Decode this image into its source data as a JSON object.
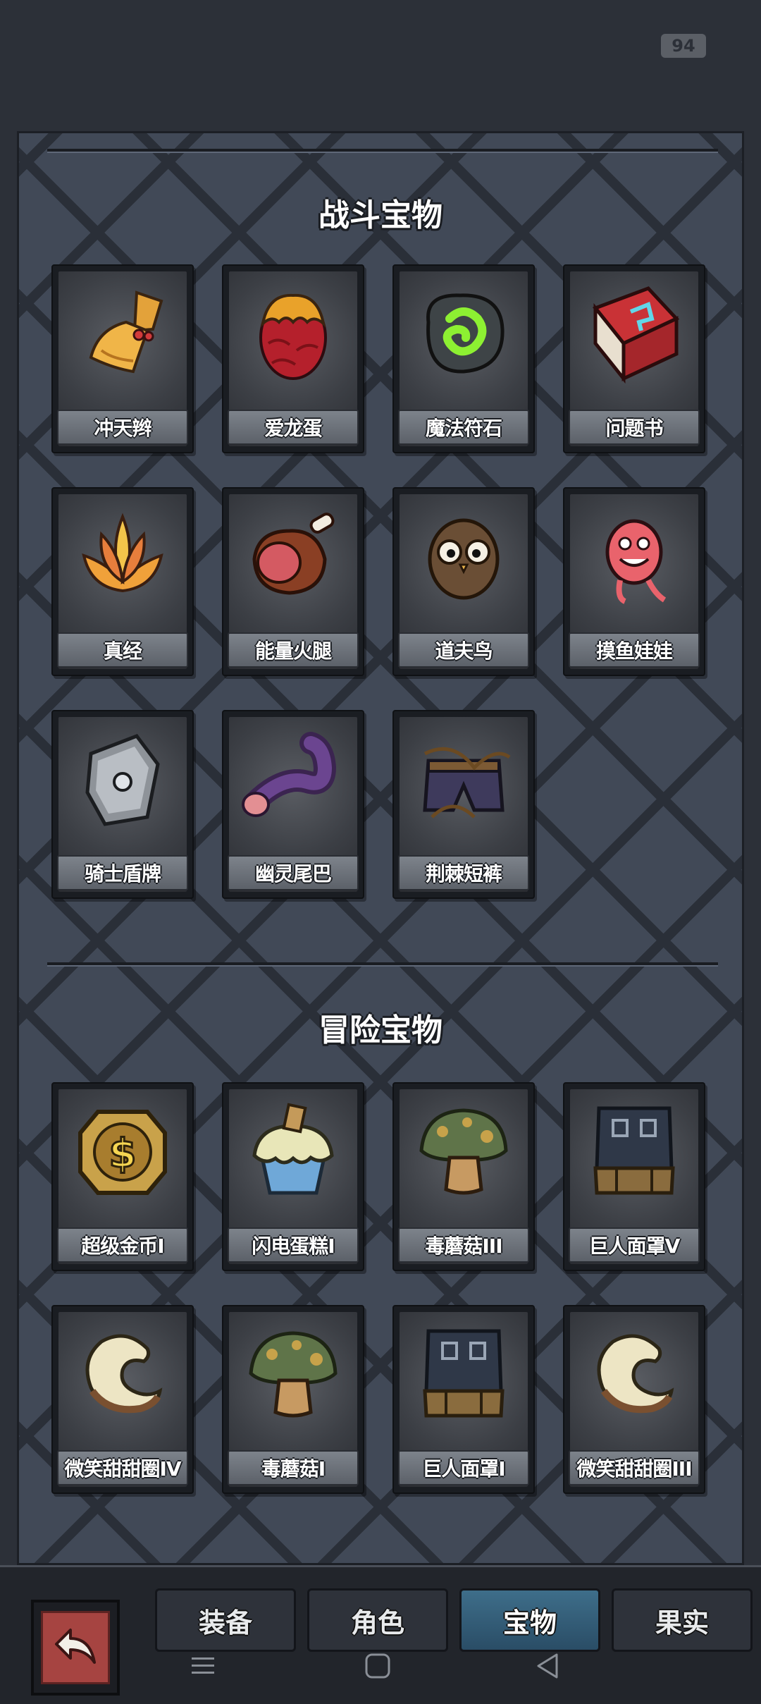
{
  "status": {
    "badge": "94"
  },
  "sections": [
    {
      "title": "战斗宝物",
      "items": [
        {
          "name": "冲天辫",
          "icon": "braid-icon"
        },
        {
          "name": "爱龙蛋",
          "icon": "dragon-egg-icon"
        },
        {
          "name": "魔法符石",
          "icon": "rune-stone-icon"
        },
        {
          "name": "问题书",
          "icon": "book-icon"
        },
        {
          "name": "真经",
          "icon": "lotus-icon"
        },
        {
          "name": "能量火腿",
          "icon": "ham-icon"
        },
        {
          "name": "道夫鸟",
          "icon": "owl-icon"
        },
        {
          "name": "摸鱼娃娃",
          "icon": "doll-icon"
        },
        {
          "name": "骑士盾牌",
          "icon": "shield-icon"
        },
        {
          "name": "幽灵尾巴",
          "icon": "tail-icon"
        },
        {
          "name": "荆棘短裤",
          "icon": "shorts-icon"
        }
      ]
    },
    {
      "title": "冒险宝物",
      "items": [
        {
          "name": "超级金币I",
          "icon": "gold-coin-icon"
        },
        {
          "name": "闪电蛋糕I",
          "icon": "cupcake-icon"
        },
        {
          "name": "毒蘑菇III",
          "icon": "mushroom-icon"
        },
        {
          "name": "巨人面罩V",
          "icon": "mask-icon"
        },
        {
          "name": "微笑甜甜圈IV",
          "icon": "donut-icon"
        },
        {
          "name": "毒蘑菇I",
          "icon": "mushroom-icon"
        },
        {
          "name": "巨人面罩I",
          "icon": "mask-icon"
        },
        {
          "name": "微笑甜甜圈III",
          "icon": "donut-icon"
        }
      ]
    }
  ],
  "tabs": [
    {
      "label": "装备"
    },
    {
      "label": "角色"
    },
    {
      "label": "宝物",
      "active": true
    },
    {
      "label": "果实"
    }
  ],
  "icons": {
    "back": "back-arrow-icon",
    "nav": [
      "menu-icon",
      "home-icon",
      "back-triangle-icon"
    ]
  }
}
